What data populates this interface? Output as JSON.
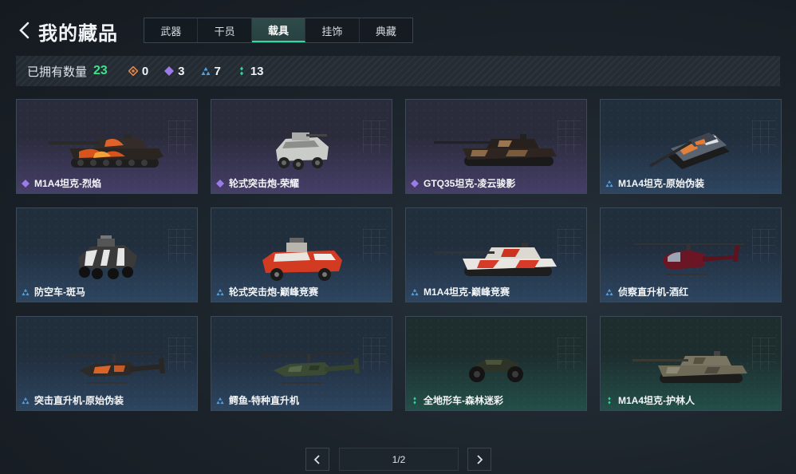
{
  "header": {
    "title": "我的藏品",
    "tabs": [
      {
        "label": "武器"
      },
      {
        "label": "干员"
      },
      {
        "label": "载具",
        "active": true
      },
      {
        "label": "挂饰"
      },
      {
        "label": "典藏"
      }
    ]
  },
  "stats": {
    "label": "已拥有数量",
    "total": "23",
    "tiers": [
      {
        "name": "orange-tier",
        "count": "0",
        "color": "#e0834a"
      },
      {
        "name": "purple-tier",
        "count": "3",
        "color": "#9b7be8"
      },
      {
        "name": "blue-tier",
        "count": "7",
        "color": "#4ea3e6"
      },
      {
        "name": "green-tier",
        "count": "13",
        "color": "#35d49a"
      }
    ]
  },
  "cards": [
    {
      "name": "M1A4坦克-烈焰",
      "rarity": "purple",
      "icon": "tank-icon"
    },
    {
      "name": "轮式突击炮-荣耀",
      "rarity": "purple",
      "icon": "armored-car-icon"
    },
    {
      "name": "GTQ35坦克-凌云骏影",
      "rarity": "purple",
      "icon": "tank-icon"
    },
    {
      "name": "M1A4坦克-原始伪装",
      "rarity": "blue",
      "icon": "tank-icon"
    },
    {
      "name": "防空车-斑马",
      "rarity": "blue",
      "icon": "armored-car-icon"
    },
    {
      "name": "轮式突击炮-巅峰竞赛",
      "rarity": "blue",
      "icon": "armored-car-icon"
    },
    {
      "name": "M1A4坦克-巅峰竞赛",
      "rarity": "blue",
      "icon": "tank-icon"
    },
    {
      "name": "侦察直升机-酒红",
      "rarity": "blue",
      "icon": "helicopter-icon"
    },
    {
      "name": "突击直升机-原始伪装",
      "rarity": "blue",
      "icon": "helicopter-icon"
    },
    {
      "name": "鳄鱼-特种直升机",
      "rarity": "blue",
      "icon": "helicopter-icon"
    },
    {
      "name": "全地形车-森林迷彩",
      "rarity": "green",
      "icon": "atv-icon"
    },
    {
      "name": "M1A4坦克-护林人",
      "rarity": "green",
      "icon": "tank-icon"
    }
  ],
  "pager": {
    "label": "1/2"
  },
  "colors": {
    "accent": "#2fdba0",
    "total": "#3fe28a"
  }
}
